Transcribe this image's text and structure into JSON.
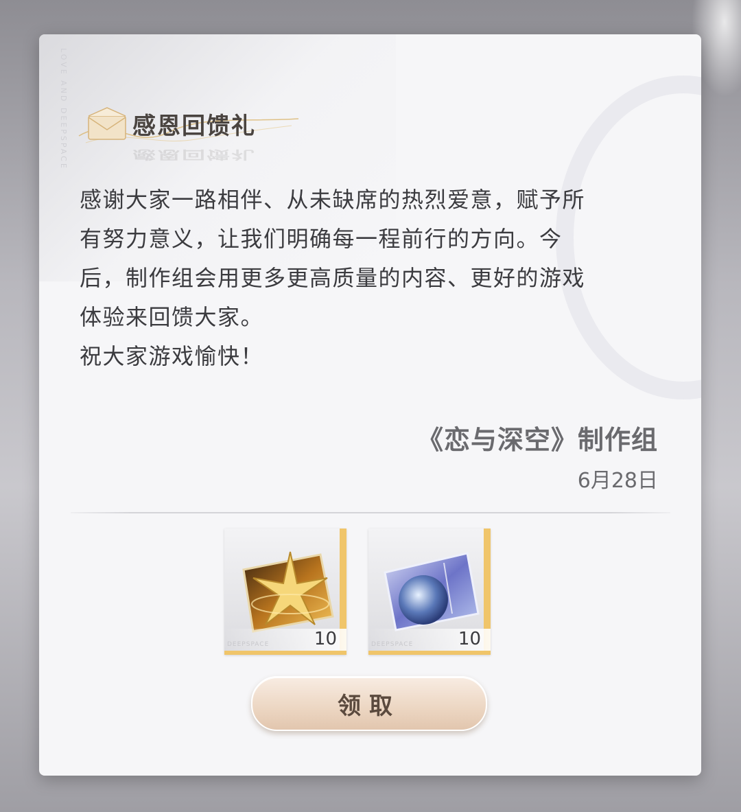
{
  "mail": {
    "title": "感恩回馈礼",
    "brand_vertical": "LOVE AND DEEPSPACE",
    "body_lines": [
      "感谢大家一路相伴、从未缺席的热烈爱意，赋予所",
      "有努力意义，让我们明确每一程前行的方向。今",
      "后，制作组会用更多更高质量的内容、更好的游戏",
      "体验来回馈大家。",
      "祝大家游戏愉快！"
    ],
    "signature": "《恋与深空》制作组",
    "date": "6月28日"
  },
  "rewards": [
    {
      "icon": "gold-star-ticket-icon",
      "quantity": "10",
      "brand": "DEEPSPACE"
    },
    {
      "icon": "globe-ticket-icon",
      "quantity": "10",
      "brand": "DEEPSPACE"
    }
  ],
  "claim_button": {
    "label": "领取"
  },
  "colors": {
    "accent_gold": "#f0c56a",
    "button": "#ecd6c2"
  }
}
